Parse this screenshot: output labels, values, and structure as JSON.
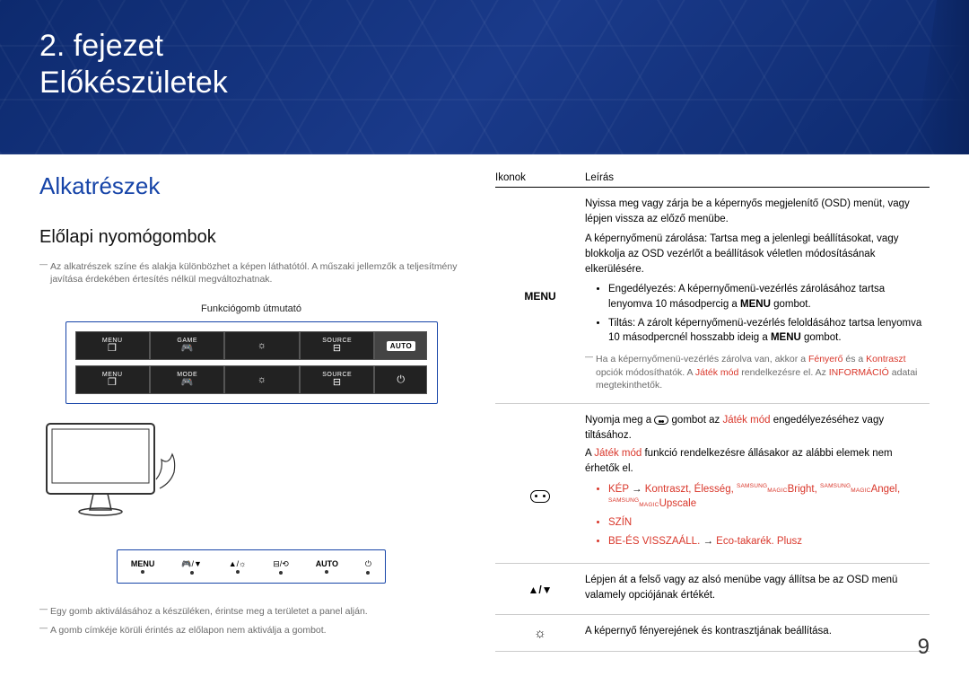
{
  "banner": {
    "chapter": "2. fejezet",
    "title": "Előkészületek"
  },
  "left": {
    "section": "Alkatrészek",
    "subsection": "Előlapi nyomógombok",
    "note1": "Az alkatrészek színe és alakja különbözhet a képen láthatótól. A műszaki jellemzők a teljesítmény javítása érdekében értesítés nélkül megváltozhatnak.",
    "guide_label": "Funkciógomb útmutató",
    "osd_labels": {
      "menu": "MENU",
      "game_top": "GAME",
      "game_bot": "MODE",
      "source": "SOURCE",
      "auto": "AUTO"
    },
    "legend": {
      "menu": "MENU",
      "auto": "AUTO"
    },
    "note2": "Egy gomb aktiválásához a készüléken, érintse meg a területet a panel alján.",
    "note3": "A gomb címkéje körüli érintés az előlapon nem aktiválja a gombot."
  },
  "table": {
    "head_icon": "Ikonok",
    "head_desc": "Leírás",
    "rows": [
      {
        "icon_text": "MENU",
        "desc_main": "Nyissa meg vagy zárja be a képernyős megjelenítő (OSD) menüt, vagy lépjen vissza az előző menübe.",
        "desc_sub": "A képernyőmenü zárolása: Tartsa meg a jelenlegi beállításokat, vagy blokkolja az OSD vezérlőt a beállítások véletlen módosításának elkerülésére.",
        "bullets": [
          "Engedélyezés: A képernyőmenü-vezérlés zárolásához tartsa lenyomva 10 másodpercig a MENU gombot.",
          "Tiltás: A zárolt képernyőmenü-vezérlés feloldásához tartsa lenyomva 10 másodpercnél hosszabb ideig a MENU gombot."
        ],
        "note": {
          "pre": "Ha a képernyőmenü-vezérlés zárolva van, akkor a ",
          "r1": "Fényerő",
          "mid1": " és a ",
          "r2": "Kontraszt",
          "mid2": " opciók módosíthatók. A ",
          "r3": "Játék mód",
          "mid3": " rendelkezésre el. Az ",
          "r4": "INFORMÁCIÓ",
          "post": " adatai megtekinthetők."
        }
      },
      {
        "icon": "game",
        "desc_line1_pre": "Nyomja meg a ",
        "desc_line1_mid": " gombot az ",
        "desc_line1_r": "Játék mód",
        "desc_line1_post": " engedélyezéséhez vagy tiltásához.",
        "desc_line2_pre": "A ",
        "desc_line2_r": "Játék mód",
        "desc_line2_post": " funkció rendelkezésre állásakor az alábbi elemek nem érhetők el.",
        "bullets_complex": true,
        "b1": {
          "kep": "KÉP",
          "arrow": " → ",
          "k1": "Kontraszt",
          "k2": "Élesség",
          "bright": "Bright",
          "angel": "Angel",
          "upscale": "Upscale"
        },
        "b2": "SZÍN",
        "b3": {
          "a": "BE-ÉS VISSZAÁLL.",
          "arrow": " → ",
          "b": "Eco-takarék. Plusz"
        }
      },
      {
        "icon": "updown",
        "desc": "Lépjen át a felső vagy az alsó menübe vagy állítsa be az OSD menü valamely opciójának értékét."
      },
      {
        "icon": "sun",
        "desc": "A képernyő fényerejének és kontrasztjának beállítása."
      }
    ]
  },
  "page_number": "9"
}
